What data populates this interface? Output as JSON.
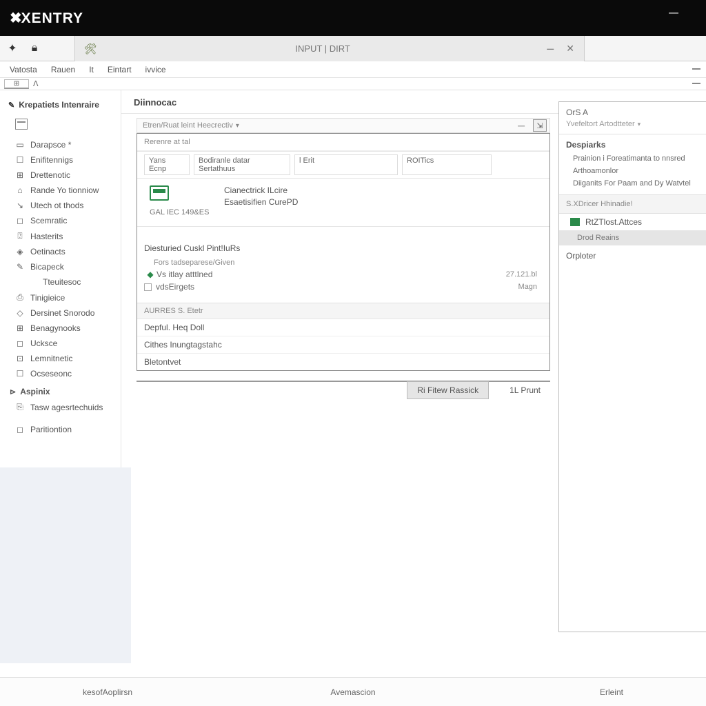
{
  "titlebar": {
    "logo": "XENTRY"
  },
  "secondary": {
    "tab_title": "INPUT | DIRT"
  },
  "menu": {
    "items": [
      "Vatosta",
      "Rauen",
      "It",
      "Eintart",
      "ivvice"
    ]
  },
  "sidebar": {
    "title": "Krepatiets Intenraire",
    "items": [
      {
        "icon": "▭",
        "label": "Darapsce *"
      },
      {
        "icon": "☐",
        "label": "Enifitennigs"
      },
      {
        "icon": "⊞",
        "label": "Drettenotic"
      },
      {
        "icon": "⌂",
        "label": "Rande Yo tionniow"
      },
      {
        "icon": "↘",
        "label": "Utech ot thods"
      },
      {
        "icon": "◻",
        "label": "Scemratic"
      },
      {
        "icon": "⍰",
        "label": "Hasterits"
      },
      {
        "icon": "◈",
        "label": "Oetinacts"
      },
      {
        "icon": "✎",
        "label": "Bicapeck"
      },
      {
        "icon": "",
        "label": "Tteuitesoc"
      },
      {
        "icon": "⎙",
        "label": "Tinigieice"
      },
      {
        "icon": "◇",
        "label": "Dersinet Snorodo"
      },
      {
        "icon": "⊞",
        "label": "Benagynooks"
      },
      {
        "icon": "◻",
        "label": "Ucksce"
      },
      {
        "icon": "⊡",
        "label": "Lemnitnetic"
      },
      {
        "icon": "☐",
        "label": "Ocseseonc"
      }
    ],
    "section": "Aspinix",
    "extra": [
      {
        "icon": "⎘",
        "label": "Tasw agesrtechuids"
      },
      {
        "icon": "◻",
        "label": "Paritiontion"
      }
    ]
  },
  "content": {
    "header": "Diinnocac",
    "filter_label": "Etren/Ruat leint Heecrectiv",
    "section1_title": "Rerenre at tal",
    "columns": [
      "Yans Ecnp",
      "Bodiranle datar Sertathuus",
      "l Erit",
      "ROITics"
    ],
    "device": {
      "line1": "Cianectrick ILcire",
      "line2": "Esaetisifien CurePD",
      "code": "GAL IEC 149&ES"
    },
    "checklist": {
      "title": "Diesturied Cuskl Pint!IuRs",
      "sub": "Fors tadseparese/Given",
      "item1": "Vs itlay atttlned",
      "item1_right": "27.121.bl",
      "item2": "vdsEirgets",
      "item2_right": "Magn"
    },
    "actions": {
      "header": "AURRES S. Etetr",
      "item1": "Depful. Heq Doll",
      "item2": "Cithes Inungtagstahc",
      "item3": "Bletontvet"
    },
    "buttons": {
      "primary": "Ri Fitew Rassick",
      "secondary": "1L Prunt"
    }
  },
  "right": {
    "title1": "OrS A",
    "sub1": "Yvefeltort Artodtteter",
    "heading": "Despiarks",
    "items": [
      "Prainion i Foreatimanta to nnsred",
      "Arthoamonlor",
      "Diiganits For Paam and Dy Watvtel"
    ],
    "tests_header": "S.XDricer Hhinadie!",
    "test1": "RtZTlost.Attces",
    "test2": "Drod Reains",
    "label": "Orploter"
  },
  "footer": {
    "left": "kesofAoplirsn",
    "mid": "Avemascion",
    "right": "Erleint"
  }
}
